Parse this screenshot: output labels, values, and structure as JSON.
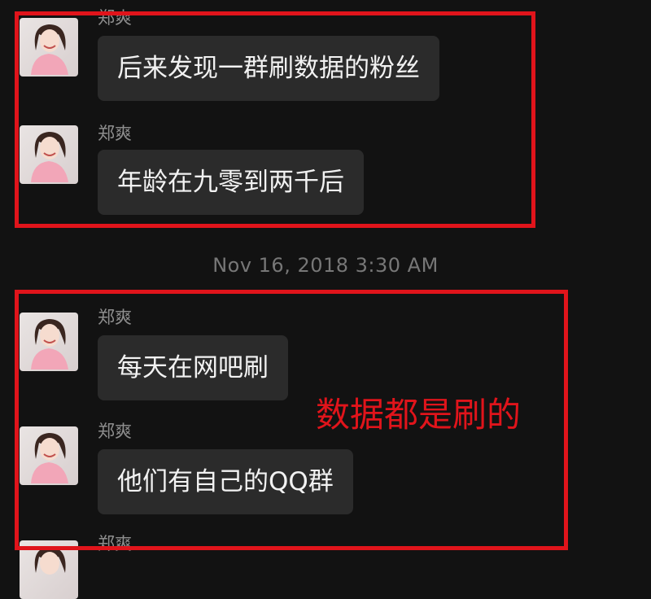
{
  "colors": {
    "background": "#121212",
    "bubble": "#2b2b2b",
    "highlight": "#e0141b"
  },
  "messages": [
    {
      "sender": "郑爽",
      "text": "后来发现一群刷数据的粉丝"
    },
    {
      "sender": "郑爽",
      "text": "年龄在九零到两千后"
    },
    {
      "sender": "郑爽",
      "text": "每天在网吧刷"
    },
    {
      "sender": "郑爽",
      "text": "他们有自己的QQ群"
    },
    {
      "sender": "郑爽"
    }
  ],
  "timestamp": "Nov 16, 2018 3:30 AM",
  "annotation": "数据都是刷的"
}
